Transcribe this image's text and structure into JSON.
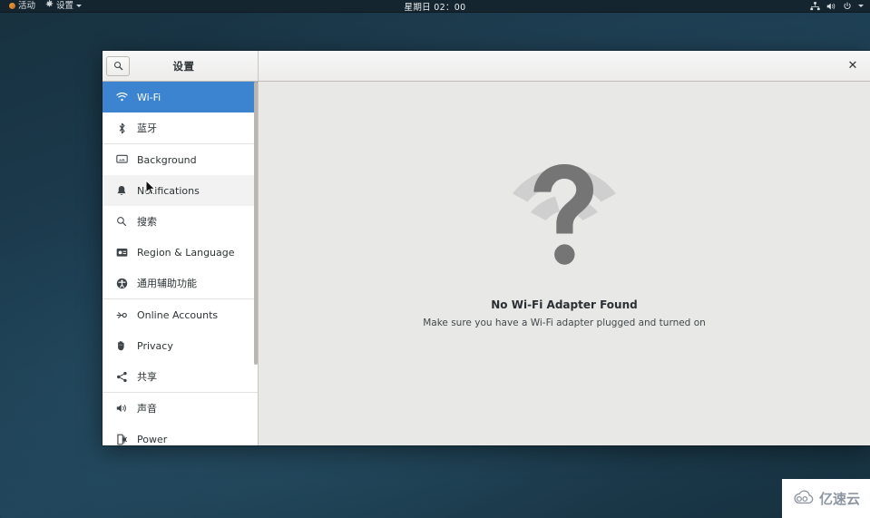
{
  "topbar": {
    "activities_label": "活动",
    "app_menu_label": "设置",
    "clock": "星期日 02：00",
    "icons": {
      "activities": "activities-dot-icon",
      "app": "settings-gear-icon",
      "app_caret": "chevron-down-icon",
      "network": "network-wired-icon",
      "volume": "volume-icon",
      "power": "power-icon",
      "menu_caret": "chevron-down-icon"
    }
  },
  "window": {
    "title": "设置",
    "search_icon": "search-icon",
    "close_label": "✕",
    "close_icon": "close-icon"
  },
  "sidebar": {
    "groups": [
      {
        "items": [
          {
            "label": "Wi-Fi",
            "icon": "wifi-icon",
            "selected": true
          },
          {
            "label": "蓝牙",
            "icon": "bluetooth-icon",
            "selected": false
          }
        ]
      },
      {
        "items": [
          {
            "label": "Background",
            "icon": "background-icon",
            "selected": false
          },
          {
            "label": "Notifications",
            "icon": "bell-icon",
            "selected": false
          },
          {
            "label": "搜索",
            "icon": "search-icon",
            "selected": false
          },
          {
            "label": "Region & Language",
            "icon": "region-language-icon",
            "selected": false
          },
          {
            "label": "通用辅助功能",
            "icon": "accessibility-icon",
            "selected": false
          }
        ]
      },
      {
        "items": [
          {
            "label": "Online Accounts",
            "icon": "online-accounts-icon",
            "selected": false
          },
          {
            "label": "Privacy",
            "icon": "privacy-hand-icon",
            "selected": false
          },
          {
            "label": "共享",
            "icon": "sharing-icon",
            "selected": false
          }
        ]
      },
      {
        "items": [
          {
            "label": "声音",
            "icon": "sound-icon",
            "selected": false
          },
          {
            "label": "Power",
            "icon": "power-plug-icon",
            "selected": false
          }
        ]
      }
    ]
  },
  "content": {
    "icon": "wifi-question-icon",
    "title": "No Wi-Fi Adapter Found",
    "subtitle": "Make sure you have a Wi-Fi adapter plugged and turned on"
  },
  "watermark": {
    "text": "亿速云",
    "icon": "cloud-icon"
  },
  "colors": {
    "accent": "#3c84d0",
    "topbar": "#14252f",
    "content_bg": "#e8e8e6",
    "icon_gray": "#757575",
    "icon_gray_light": "#cfcfcf",
    "desktop": "#1d3d51"
  }
}
